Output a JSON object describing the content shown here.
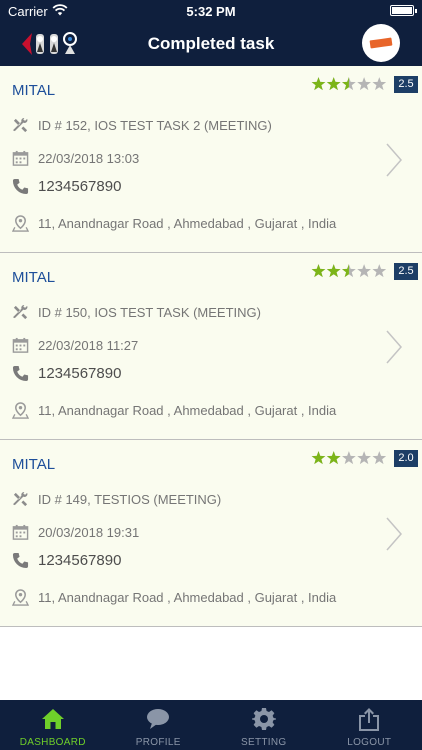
{
  "status_bar": {
    "carrier": "Carrier",
    "time": "5:32 PM"
  },
  "header": {
    "title": "Completed task"
  },
  "colors": {
    "nav_bg": "#0f1f3d",
    "card_bg": "#fafcef",
    "name_color": "#1e4f9a",
    "star_on": "#7cb518",
    "star_off": "#b5b5b5",
    "badge_bg": "#1d3e66",
    "tab_active": "#6fcf2a"
  },
  "tasks": [
    {
      "name": "MITAL",
      "rating": 2.5,
      "rating_label": "2.5",
      "task": "ID # 152, IOS TEST TASK 2 (MEETING)",
      "datetime": "22/03/2018 13:03",
      "phone": "1234567890",
      "address": "11, Anandnagar Road , Ahmedabad , Gujarat , India"
    },
    {
      "name": "MITAL",
      "rating": 2.5,
      "rating_label": "2.5",
      "task": "ID # 150, IOS TEST TASK (MEETING)",
      "datetime": "22/03/2018 11:27",
      "phone": "1234567890",
      "address": "11, Anandnagar Road , Ahmedabad , Gujarat , India"
    },
    {
      "name": "MITAL",
      "rating": 2.0,
      "rating_label": "2.0",
      "task": "ID # 149, TESTIOS (MEETING)",
      "datetime": "20/03/2018 19:31",
      "phone": "1234567890",
      "address": "11, Anandnagar Road , Ahmedabad , Gujarat , India"
    }
  ],
  "tabs": [
    {
      "label": "DASHBOARD",
      "icon": "home-icon",
      "active": true
    },
    {
      "label": "PROFILE",
      "icon": "chat-bubble-icon",
      "active": false
    },
    {
      "label": "SETTING",
      "icon": "gear-icon",
      "active": false
    },
    {
      "label": "LOGOUT",
      "icon": "share-icon",
      "active": false
    }
  ]
}
